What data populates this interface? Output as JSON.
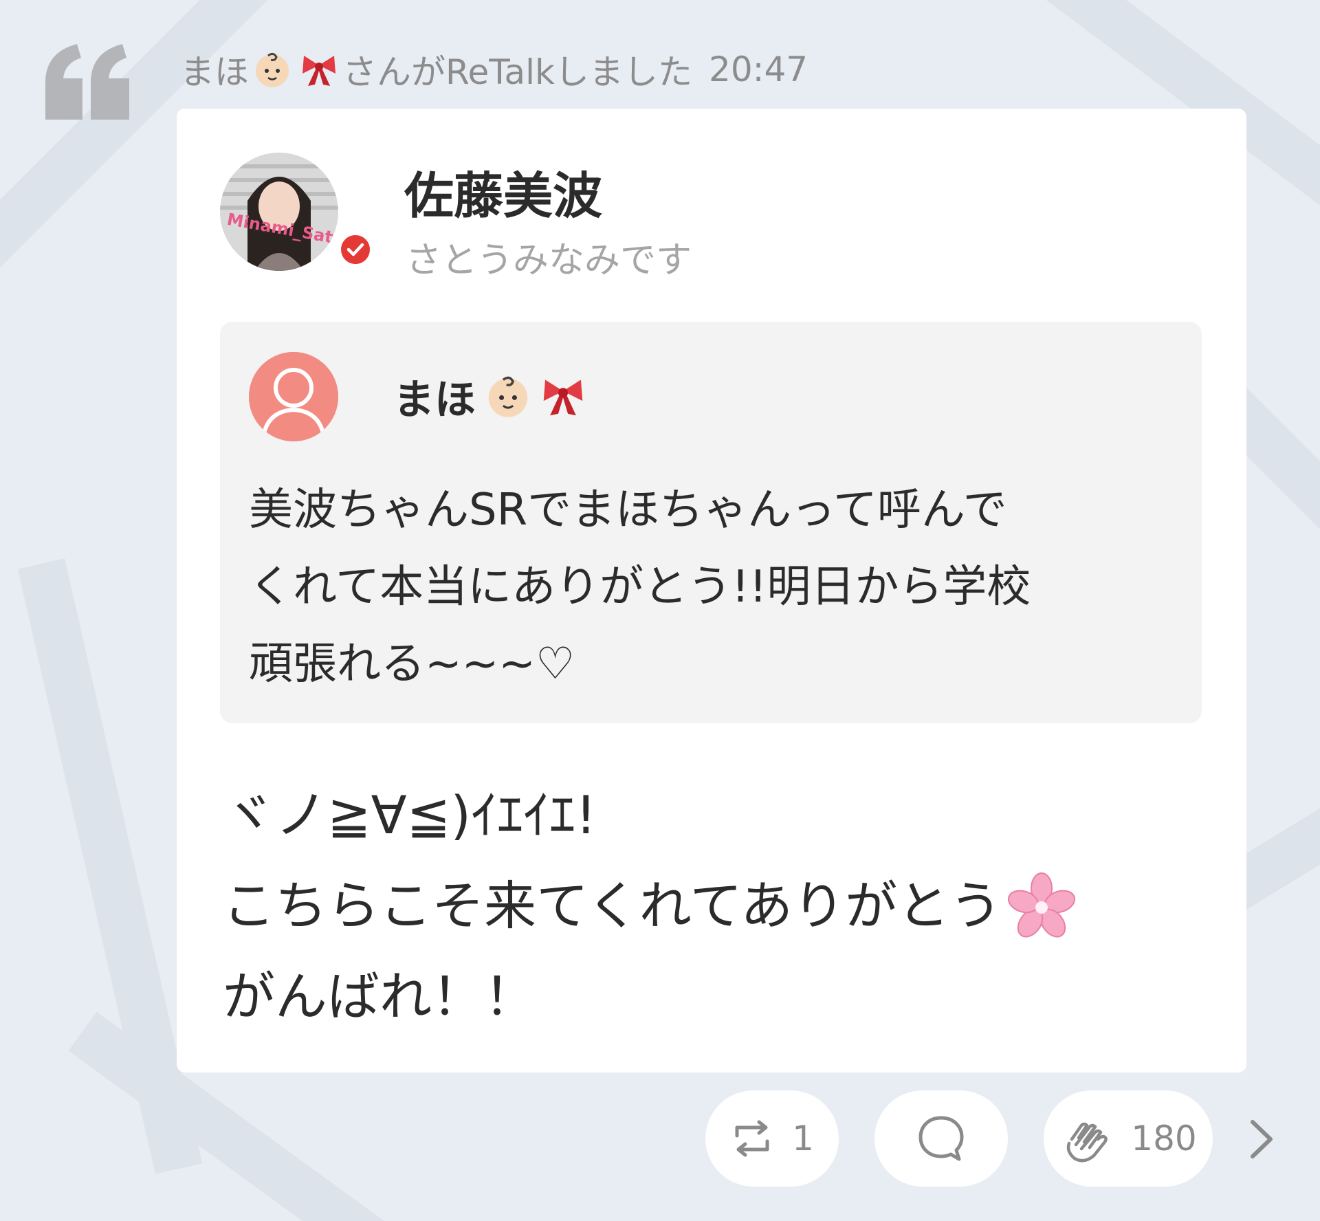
{
  "retalk": {
    "user_name": "まほ",
    "emoji_1": "baby-emoji",
    "emoji_2": "ribbon-emoji",
    "action_text": "さんがReTalkしました",
    "time": "20:47"
  },
  "author": {
    "name": "佐藤美波",
    "handle": "さとうみなみです",
    "verified": true,
    "avatar_overlay_text": "Minami_Sato"
  },
  "quoted": {
    "user_name": "まほ",
    "emoji_1": "baby-emoji",
    "emoji_2": "ribbon-emoji",
    "lines": [
      "美波ちゃんSRでまほちゃんって呼んで",
      "くれて本当にありがとう!!明日から学校",
      "頑張れる~~~♡"
    ]
  },
  "post": {
    "lines": [
      "ヾノ≧∀≦)ｲｴｲｴ!",
      "こちらこそ来てくれてありがとう",
      "がんばれ！！"
    ],
    "line_2_emoji": "cherry-blossom-emoji"
  },
  "actions": {
    "retalk_count": "1",
    "reply_count": "",
    "clap_count": "180",
    "icons": [
      "retalk-icon",
      "reply-icon",
      "clap-icon",
      "chevron-right-icon"
    ]
  },
  "colors": {
    "background": "#e8edf3",
    "card": "#ffffff",
    "quoted_bg": "#f3f3f3",
    "verified_red": "#e53935",
    "default_avatar": "#f28b82",
    "muted_text": "#8c8c8c"
  }
}
